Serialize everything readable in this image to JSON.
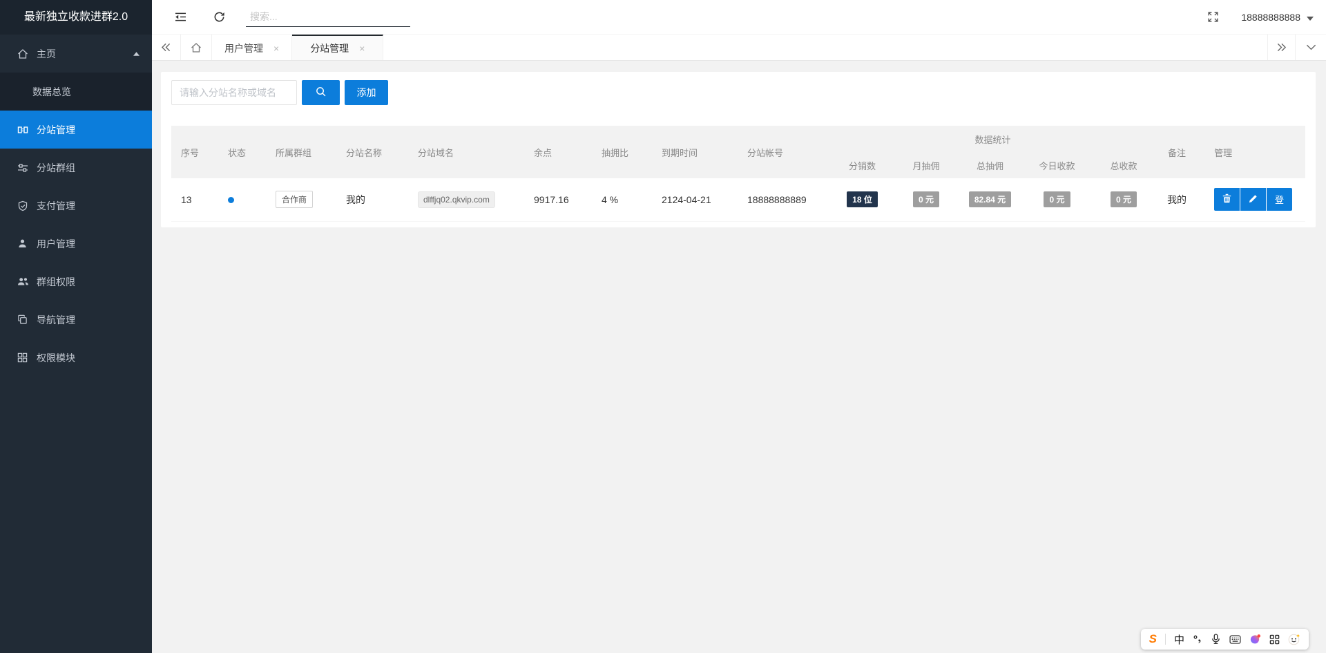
{
  "app": {
    "accent_color": "#0c7ddb",
    "sidebar_bg": "#212b36",
    "active_tab_border": "#23292e"
  },
  "sidebar": {
    "title": "最新独立收款进群2.0",
    "items": [
      {
        "label": "主页",
        "icon": "home-icon",
        "expanded": true
      },
      {
        "label": "数据总览",
        "submenu_of": "主页"
      },
      {
        "label": "分站管理",
        "icon": "sites-icon",
        "active": true
      },
      {
        "label": "分站群组",
        "icon": "site-groups-icon"
      },
      {
        "label": "支付管理",
        "icon": "payment-icon"
      },
      {
        "label": "用户管理",
        "icon": "user-icon"
      },
      {
        "label": "群组权限",
        "icon": "group-permission-icon"
      },
      {
        "label": "导航管理",
        "icon": "nav-icon"
      },
      {
        "label": "权限模块",
        "icon": "modules-icon"
      }
    ]
  },
  "topbar": {
    "search_placeholder": "搜索...",
    "account": "18888888888"
  },
  "tabbar": {
    "tabs": [
      {
        "label": "用户管理"
      },
      {
        "label": "分站管理",
        "active": true
      }
    ]
  },
  "toolbar": {
    "filter_placeholder": "请输入分站名称或域名",
    "add_label": "添加"
  },
  "table": {
    "group_header": "数据统计",
    "headers": {
      "seq": "序号",
      "status": "状态",
      "group": "所属群组",
      "site_name": "分站名称",
      "domain": "分站域名",
      "balance": "余点",
      "rate": "抽拥比",
      "expire": "到期时间",
      "account": "分站帐号",
      "remark": "备注",
      "manage": "管理"
    },
    "stat_headers": [
      "分销数",
      "月抽佣",
      "总抽佣",
      "今日收款",
      "总收款"
    ],
    "rows": [
      {
        "seq": "13",
        "status_color": "#0c7ddb",
        "group_tag": "合作商",
        "site_name": "我的",
        "domain": "dlffjq02.qkvip.com",
        "balance": "9917.16",
        "rate": "4 %",
        "expire": "2124-04-21",
        "account": "18888888889",
        "stats": [
          {
            "text": "18 位",
            "style": "dark",
            "color": "#22344c"
          },
          {
            "text": "0 元",
            "style": "gray",
            "color": "#9e9e9e"
          },
          {
            "text": "82.84 元",
            "style": "gray",
            "color": "#9e9e9e"
          },
          {
            "text": "0 元",
            "style": "gray",
            "color": "#9e9e9e"
          },
          {
            "text": "0 元",
            "style": "gray",
            "color": "#9e9e9e"
          }
        ],
        "remark": "我的",
        "actions": {
          "login_label": "登"
        }
      }
    ]
  },
  "icons": {
    "close": "×"
  },
  "taskbar": {
    "logo": "S",
    "ime_mode": "中"
  }
}
